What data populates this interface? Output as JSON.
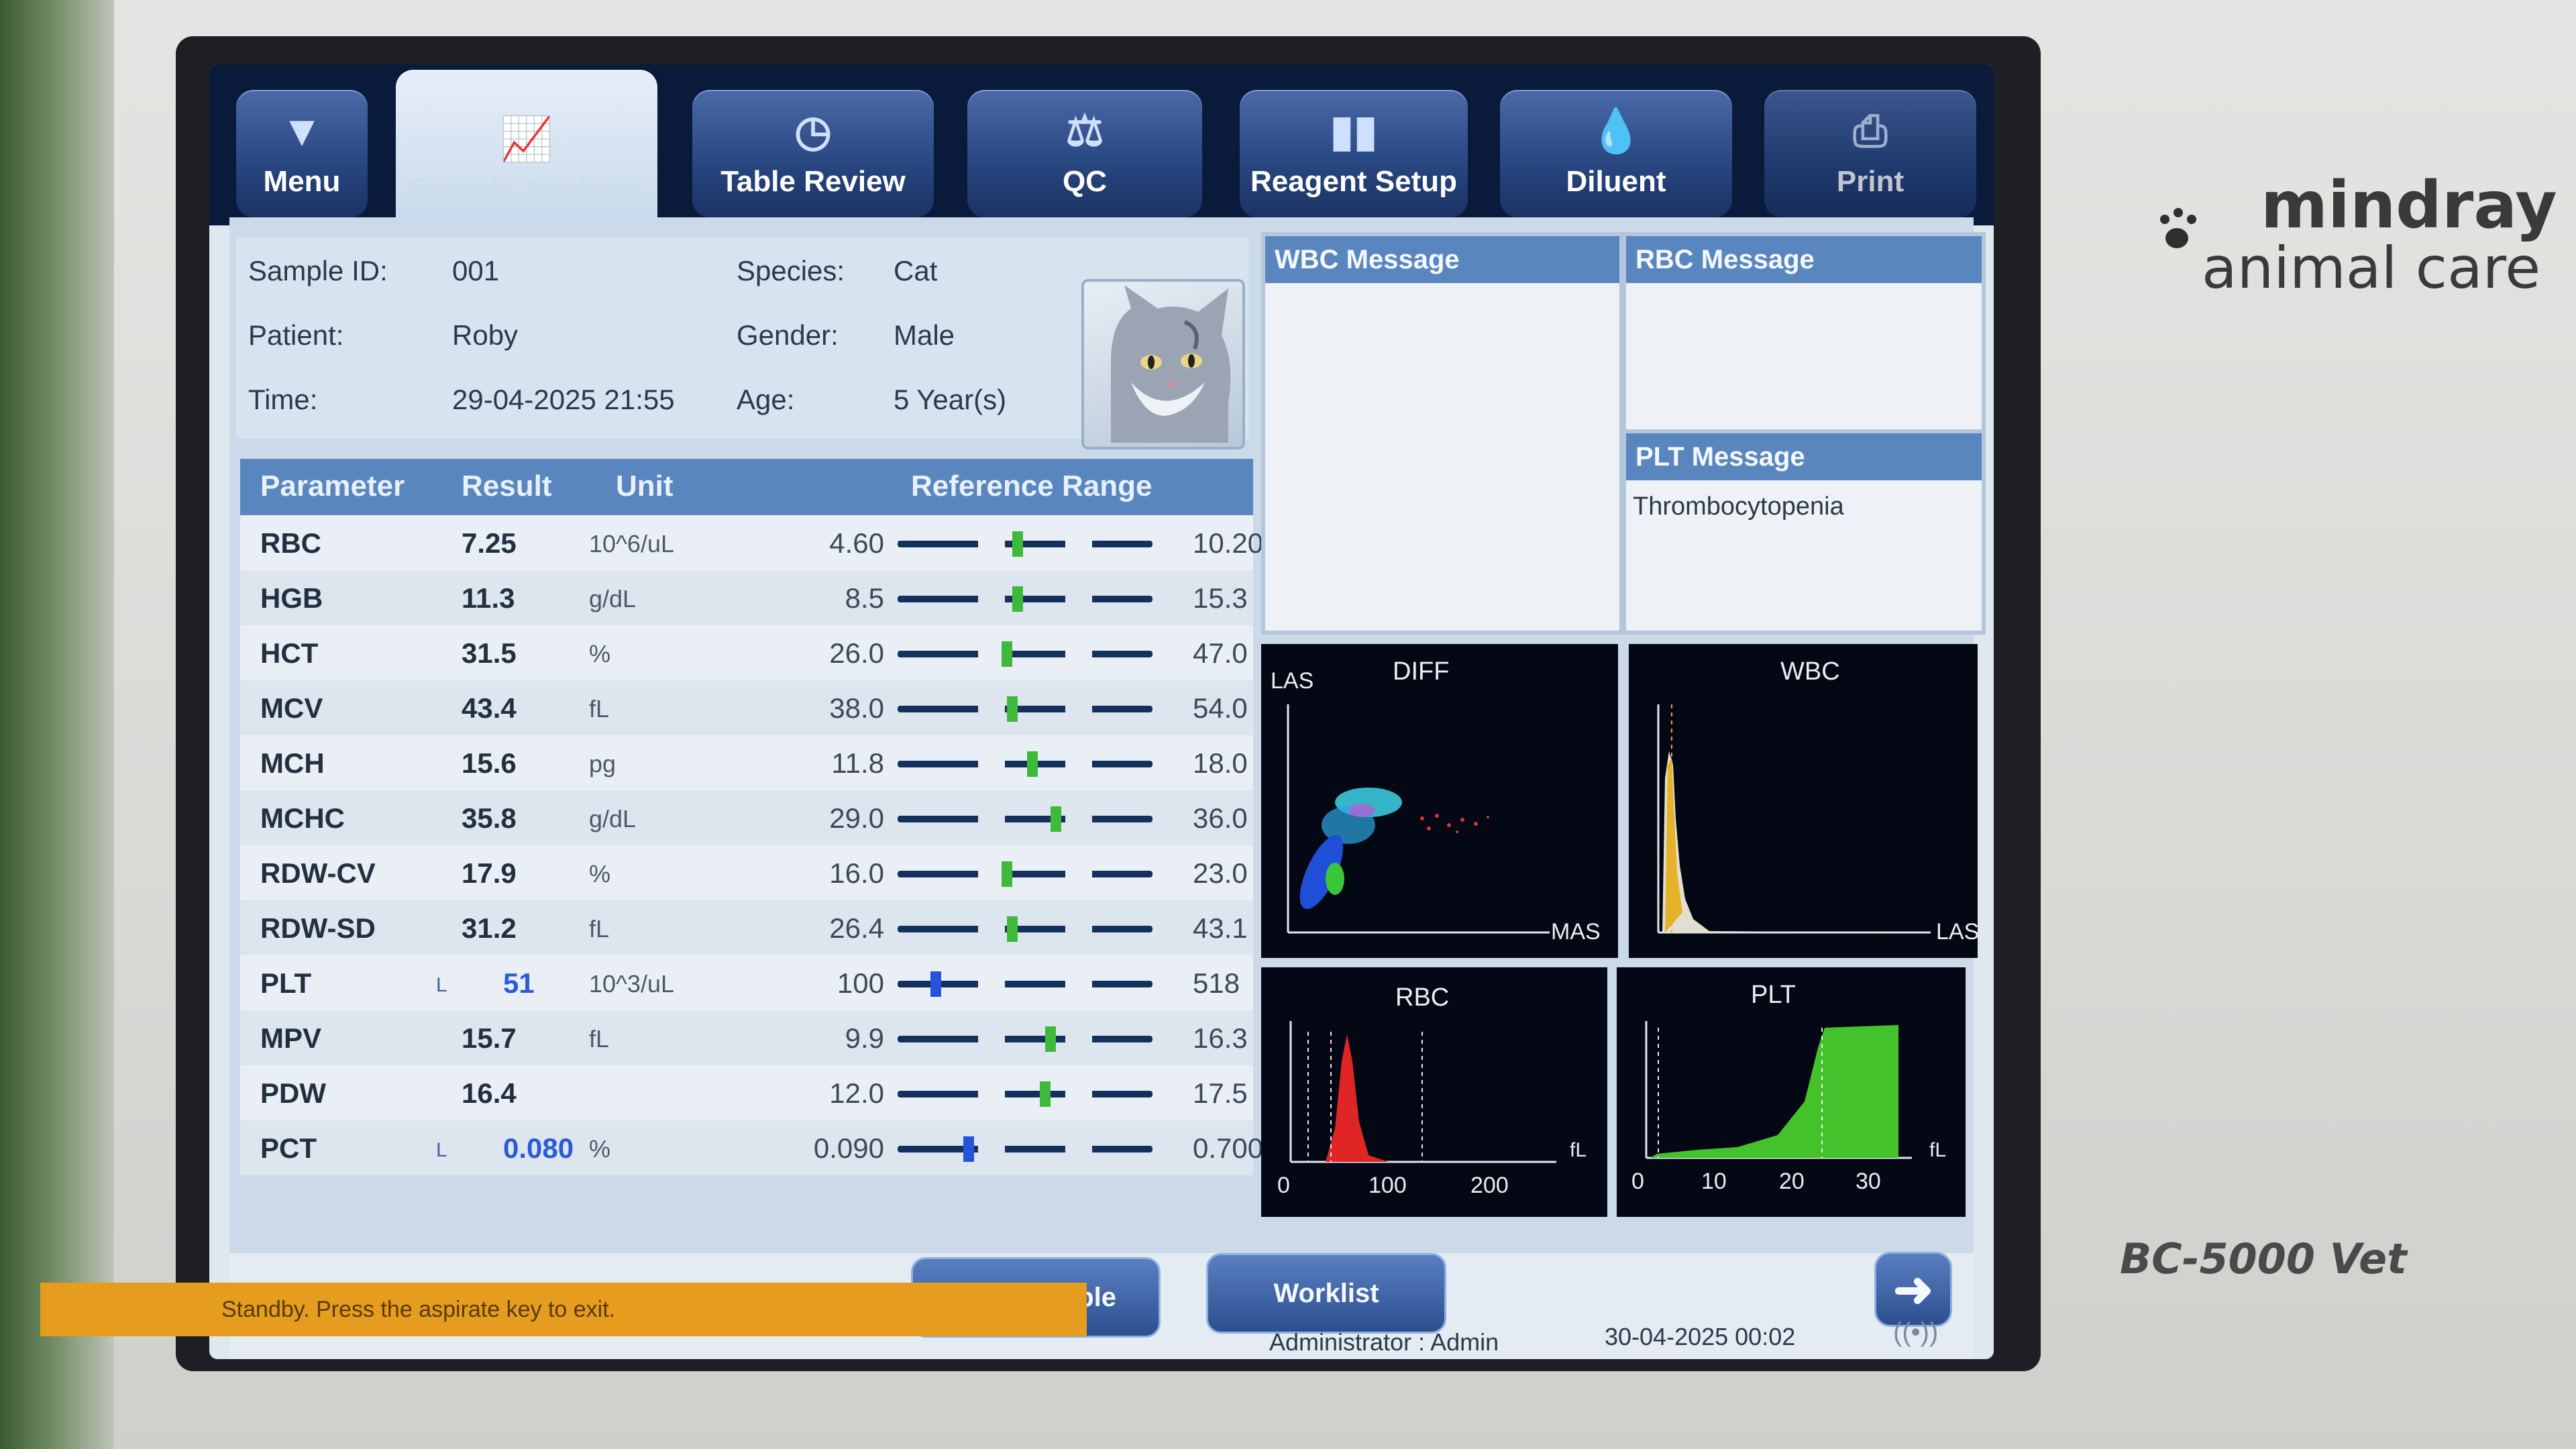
{
  "tabs": [
    {
      "label": "Menu",
      "icon": "triangle-down-icon"
    },
    {
      "label": "Sample Analysis",
      "icon": "chart-icon",
      "active": true
    },
    {
      "label": "Table Review",
      "icon": "clock-icon"
    },
    {
      "label": "QC",
      "icon": "scale-icon"
    },
    {
      "label": "Reagent Setup",
      "icon": "bottles-icon"
    },
    {
      "label": "Diluent",
      "icon": "drop-plus-icon"
    },
    {
      "label": "Print",
      "icon": "printer-icon"
    }
  ],
  "sample": {
    "id_label": "Sample ID:",
    "id_value": "001",
    "patient_label": "Patient:",
    "patient_value": "Roby",
    "time_label": "Time:",
    "time_value": "29-04-2025 21:55",
    "species_label": "Species:",
    "species_value": "Cat",
    "gender_label": "Gender:",
    "gender_value": "Male",
    "age_label": "Age:",
    "age_value": "5 Year(s)"
  },
  "table": {
    "headers": [
      "Parameter",
      "Result",
      "Unit",
      "Reference Range"
    ],
    "rows": [
      {
        "param": "RBC",
        "flag": "",
        "result": "7.25",
        "unit": "10^6/uL",
        "low": "4.60",
        "high": "10.20",
        "pos": 0.47,
        "abnormal": false
      },
      {
        "param": "HGB",
        "flag": "",
        "result": "11.3",
        "unit": "g/dL",
        "low": "8.5",
        "high": "15.3",
        "pos": 0.47,
        "abnormal": false
      },
      {
        "param": "HCT",
        "flag": "",
        "result": "31.5",
        "unit": "%",
        "low": "26.0",
        "high": "47.0",
        "pos": 0.43,
        "abnormal": false
      },
      {
        "param": "MCV",
        "flag": "",
        "result": "43.4",
        "unit": "fL",
        "low": "38.0",
        "high": "54.0",
        "pos": 0.45,
        "abnormal": false
      },
      {
        "param": "MCH",
        "flag": "",
        "result": "15.6",
        "unit": "pg",
        "low": "11.8",
        "high": "18.0",
        "pos": 0.53,
        "abnormal": false
      },
      {
        "param": "MCHC",
        "flag": "",
        "result": "35.8",
        "unit": "g/dL",
        "low": "29.0",
        "high": "36.0",
        "pos": 0.62,
        "abnormal": false
      },
      {
        "param": "RDW-CV",
        "flag": "",
        "result": "17.9",
        "unit": "%",
        "low": "16.0",
        "high": "23.0",
        "pos": 0.43,
        "abnormal": false
      },
      {
        "param": "RDW-SD",
        "flag": "",
        "result": "31.2",
        "unit": "fL",
        "low": "26.4",
        "high": "43.1",
        "pos": 0.45,
        "abnormal": false
      },
      {
        "param": "PLT",
        "flag": "L",
        "result": "51",
        "unit": "10^3/uL",
        "low": "100",
        "high": "518",
        "pos": 0.15,
        "abnormal": true
      },
      {
        "param": "MPV",
        "flag": "",
        "result": "15.7",
        "unit": "fL",
        "low": "9.9",
        "high": "16.3",
        "pos": 0.6,
        "abnormal": false
      },
      {
        "param": "PDW",
        "flag": "",
        "result": "16.4",
        "unit": "",
        "low": "12.0",
        "high": "17.5",
        "pos": 0.58,
        "abnormal": false
      },
      {
        "param": "PCT",
        "flag": "L",
        "result": "0.080",
        "unit": "%",
        "low": "0.090",
        "high": "0.700",
        "pos": 0.28,
        "abnormal": true
      }
    ]
  },
  "messages": {
    "wbc_title": "WBC Message",
    "wbc_text": "",
    "rbc_title": "RBC Message",
    "rbc_text": "",
    "plt_title": "PLT Message",
    "plt_text": "Thrombocytopenia"
  },
  "plots": {
    "diff": {
      "title": "DIFF",
      "ylabel": "LAS",
      "xlabel": "MAS"
    },
    "wbc": {
      "title": "WBC",
      "xlabel": "LAS"
    },
    "rbc": {
      "title": "RBC",
      "unit": "fL",
      "ticks": [
        "0",
        "100",
        "200"
      ]
    },
    "plt": {
      "title": "PLT",
      "unit": "fL",
      "ticks": [
        "0",
        "10",
        "20",
        "30"
      ]
    }
  },
  "footer": {
    "next_sample": "Next Sample",
    "worklist": "Worklist",
    "user": "Administrator : Admin",
    "datetime": "30-04-2025 00:02",
    "status": "Standby. Press the aspirate key to exit."
  },
  "brand": {
    "name": "mindray",
    "sub": "animal care",
    "model": "BC-5000 Vet"
  },
  "colors": {
    "normal_marker": "#3fb93a",
    "low_marker": "#2554d8",
    "plt_fill": "#44c22b",
    "rbc_fill": "#e02525",
    "status_bar": "#e59c1f"
  }
}
